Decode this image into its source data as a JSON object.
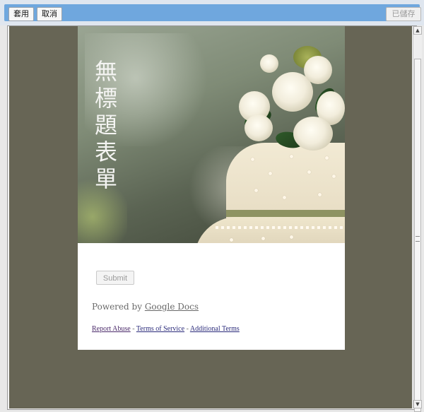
{
  "toolbar": {
    "apply_label": "套用",
    "cancel_label": "取消",
    "saved_label": "已儲存"
  },
  "form": {
    "title": "無標題表單",
    "submit_label": "Submit",
    "powered_prefix": "Powered by",
    "powered_link": "Google Docs",
    "footer": {
      "report_abuse": "Report Abuse",
      "separator": "-",
      "terms": "Terms of Service",
      "additional_terms": "Additional Terms"
    }
  },
  "icons": {
    "scroll_up": "scroll-up-arrow-icon",
    "scroll_down": "scroll-down-arrow-icon"
  },
  "colors": {
    "toolbar_blue": "#6fa7de",
    "canvas_bg": "#676555"
  }
}
